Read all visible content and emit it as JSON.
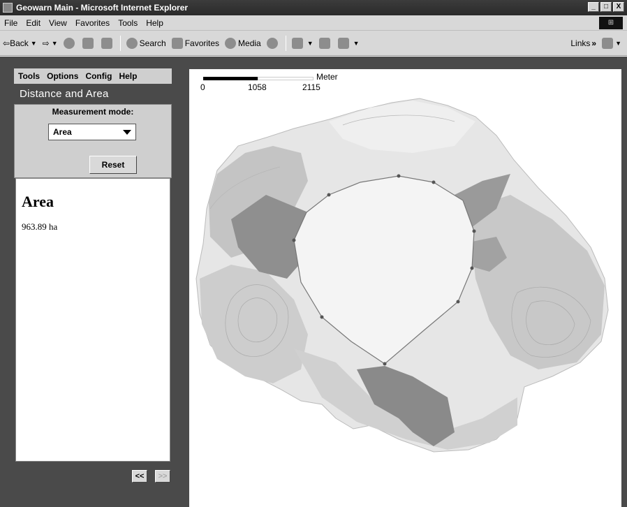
{
  "window": {
    "title": "Geowarn Main - Microsoft Internet Explorer",
    "buttons": [
      "_",
      "□",
      "X"
    ]
  },
  "menubar": {
    "items": [
      "File",
      "Edit",
      "View",
      "Favorites",
      "Tools",
      "Help"
    ]
  },
  "toolbar": {
    "back": "Back",
    "search": "Search",
    "favorites": "Favorites",
    "media": "Media",
    "links": "Links",
    "chevron": "»"
  },
  "panel": {
    "menu": [
      "Tools",
      "Options",
      "Config",
      "Help"
    ],
    "title": "Distance and Area",
    "mode_label": "Measurement mode:",
    "mode_value": "Area",
    "reset": "Reset",
    "result_title": "Area",
    "result_value": "963.89 ha",
    "prev": "<<",
    "next": ">>"
  },
  "map": {
    "scale": {
      "unit": "Meter",
      "ticks": [
        "0",
        "1058",
        "2115"
      ]
    },
    "colors": {
      "light": "#e6e6e6",
      "mid": "#c4c4c4",
      "dark": "#8f8f8f",
      "polygon": "#f4f4f4"
    }
  }
}
